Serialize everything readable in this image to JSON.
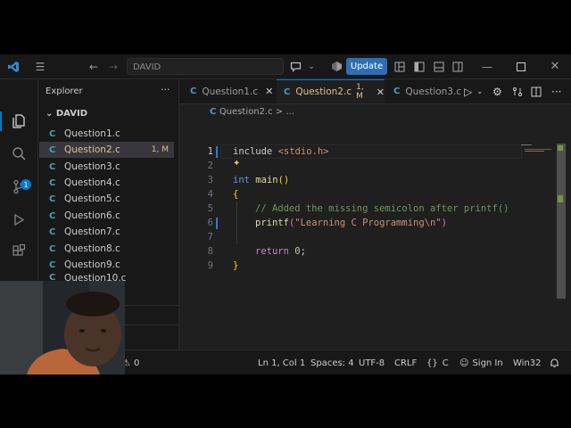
{
  "titlebar": {
    "search_text": "DAVID",
    "update_label": "Update"
  },
  "activity": {
    "scm_badge": "1"
  },
  "explorer": {
    "title": "Explorer",
    "more": "···",
    "folder": "DAVID",
    "files": [
      {
        "name": "Question1.c",
        "badge": ""
      },
      {
        "name": "Question2.c",
        "badge": "1, M"
      },
      {
        "name": "Question3.c",
        "badge": ""
      },
      {
        "name": "Question4.c",
        "badge": ""
      },
      {
        "name": "Question5.c",
        "badge": ""
      },
      {
        "name": "Question6.c",
        "badge": ""
      },
      {
        "name": "Question7.c",
        "badge": ""
      },
      {
        "name": "Question8.c",
        "badge": ""
      },
      {
        "name": "Question9.c",
        "badge": ""
      },
      {
        "name": "Question10.c",
        "badge": ""
      }
    ]
  },
  "tabs": [
    {
      "label": "Question1.c",
      "flag": ""
    },
    {
      "label": "Question2.c",
      "flag": "1, M"
    },
    {
      "label": "Question3.c",
      "flag": ""
    }
  ],
  "breadcrumb": "Question2.c > ...",
  "code": {
    "line_numbers": [
      "1",
      "2",
      "3",
      "4",
      "5",
      "6",
      "7",
      "8",
      "9"
    ],
    "l1_include": "include",
    "l1_header": "<stdio.h>",
    "l3_type": "int",
    "l3_name": "main",
    "l3_parens": "()",
    "l4_brace": "{",
    "l5_comment": "// Added the missing semicolon after printf()",
    "l6_fn": "printf",
    "l6_open": "(",
    "l6_str": "\"Learning C Programming\\n\"",
    "l6_close": ")",
    "l8_kw": "return",
    "l8_num": "0",
    "l8_semi": ";",
    "l9_brace": "}"
  },
  "status": {
    "warnings": "0",
    "position": "Ln 1, Col 1",
    "spaces": "Spaces: 4",
    "encoding": "UTF-8",
    "eol": "CRLF",
    "language": "C",
    "signin": "Sign In",
    "platform": "Win32"
  },
  "colors": {
    "accent": "#0078d4",
    "modified": "#e2c08d",
    "c_icon": "#519aba",
    "update_button": "#2f6db5"
  },
  "icons": [
    "vscode-logo-icon",
    "menu-icon",
    "back-icon",
    "forward-icon",
    "copilot-icon",
    "chevron-down-icon",
    "profile-icon",
    "layout-icon",
    "minimize-icon",
    "maximize-icon",
    "close-icon",
    "files-icon",
    "search-icon",
    "source-control-icon",
    "run-debug-icon",
    "extensions-icon",
    "run-icon",
    "settings-icon",
    "split-editor-icon",
    "more-icon",
    "bell-icon",
    "sparkle-icon",
    "warning-icon"
  ]
}
